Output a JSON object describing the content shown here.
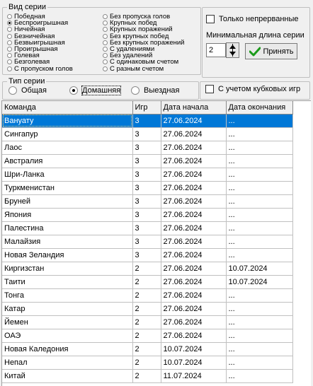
{
  "series_type_group": {
    "title": "Вид серии",
    "left_options": [
      "Победная",
      "Беспроигрышная",
      "Ничейная",
      "Безничейная",
      "Безвыигрышная",
      "Проигрышная",
      "Голевая",
      "Безголевая",
      "С пропуском голов"
    ],
    "right_options": [
      "Без пропуска голов",
      "Крупных побед",
      "Крупных поражений",
      "Без крупных побед",
      "Без крупных поражений",
      "С удалениями",
      "Без удалений",
      "С одинаковым счетом",
      "С разным счетом"
    ],
    "selected": "Беспроигрышная"
  },
  "only_continuous_label": "Только непрерванные",
  "min_length_label": "Минимальная длина серии",
  "min_length_value": "2",
  "apply_label": "Принять",
  "game_type_group": {
    "title": "Тип серии",
    "options": [
      "Общая",
      "Домашняя",
      "Выездная"
    ],
    "selected": "Домашняя"
  },
  "cup_games_label": "С учетом кубковых игр",
  "table": {
    "headers": [
      "Команда",
      "Игр",
      "Дата начала",
      "Дата окончания"
    ],
    "rows": [
      [
        "Вануату",
        "3",
        "27.06.2024",
        "..."
      ],
      [
        "Сингапур",
        "3",
        "27.06.2024",
        "..."
      ],
      [
        "Лаос",
        "3",
        "27.06.2024",
        "..."
      ],
      [
        "Австралия",
        "3",
        "27.06.2024",
        "..."
      ],
      [
        "Шри-Ланка",
        "3",
        "27.06.2024",
        "..."
      ],
      [
        "Туркменистан",
        "3",
        "27.06.2024",
        "..."
      ],
      [
        "Бруней",
        "3",
        "27.06.2024",
        "..."
      ],
      [
        "Япония",
        "3",
        "27.06.2024",
        "..."
      ],
      [
        "Палестина",
        "3",
        "27.06.2024",
        "..."
      ],
      [
        "Малайзия",
        "3",
        "27.06.2024",
        "..."
      ],
      [
        "Новая Зеландия",
        "3",
        "27.06.2024",
        "..."
      ],
      [
        "Киргизстан",
        "2",
        "27.06.2024",
        "10.07.2024"
      ],
      [
        "Таити",
        "2",
        "27.06.2024",
        "10.07.2024"
      ],
      [
        "Тонга",
        "2",
        "27.06.2024",
        "..."
      ],
      [
        "Катар",
        "2",
        "27.06.2024",
        "..."
      ],
      [
        "Йемен",
        "2",
        "27.06.2024",
        "..."
      ],
      [
        "ОАЭ",
        "2",
        "27.06.2024",
        "..."
      ],
      [
        "Новая Каледония",
        "2",
        "10.07.2024",
        "..."
      ],
      [
        "Непал",
        "2",
        "10.07.2024",
        "..."
      ],
      [
        "Китай",
        "2",
        "11.07.2024",
        "..."
      ]
    ],
    "selected_row": "Вануату"
  }
}
